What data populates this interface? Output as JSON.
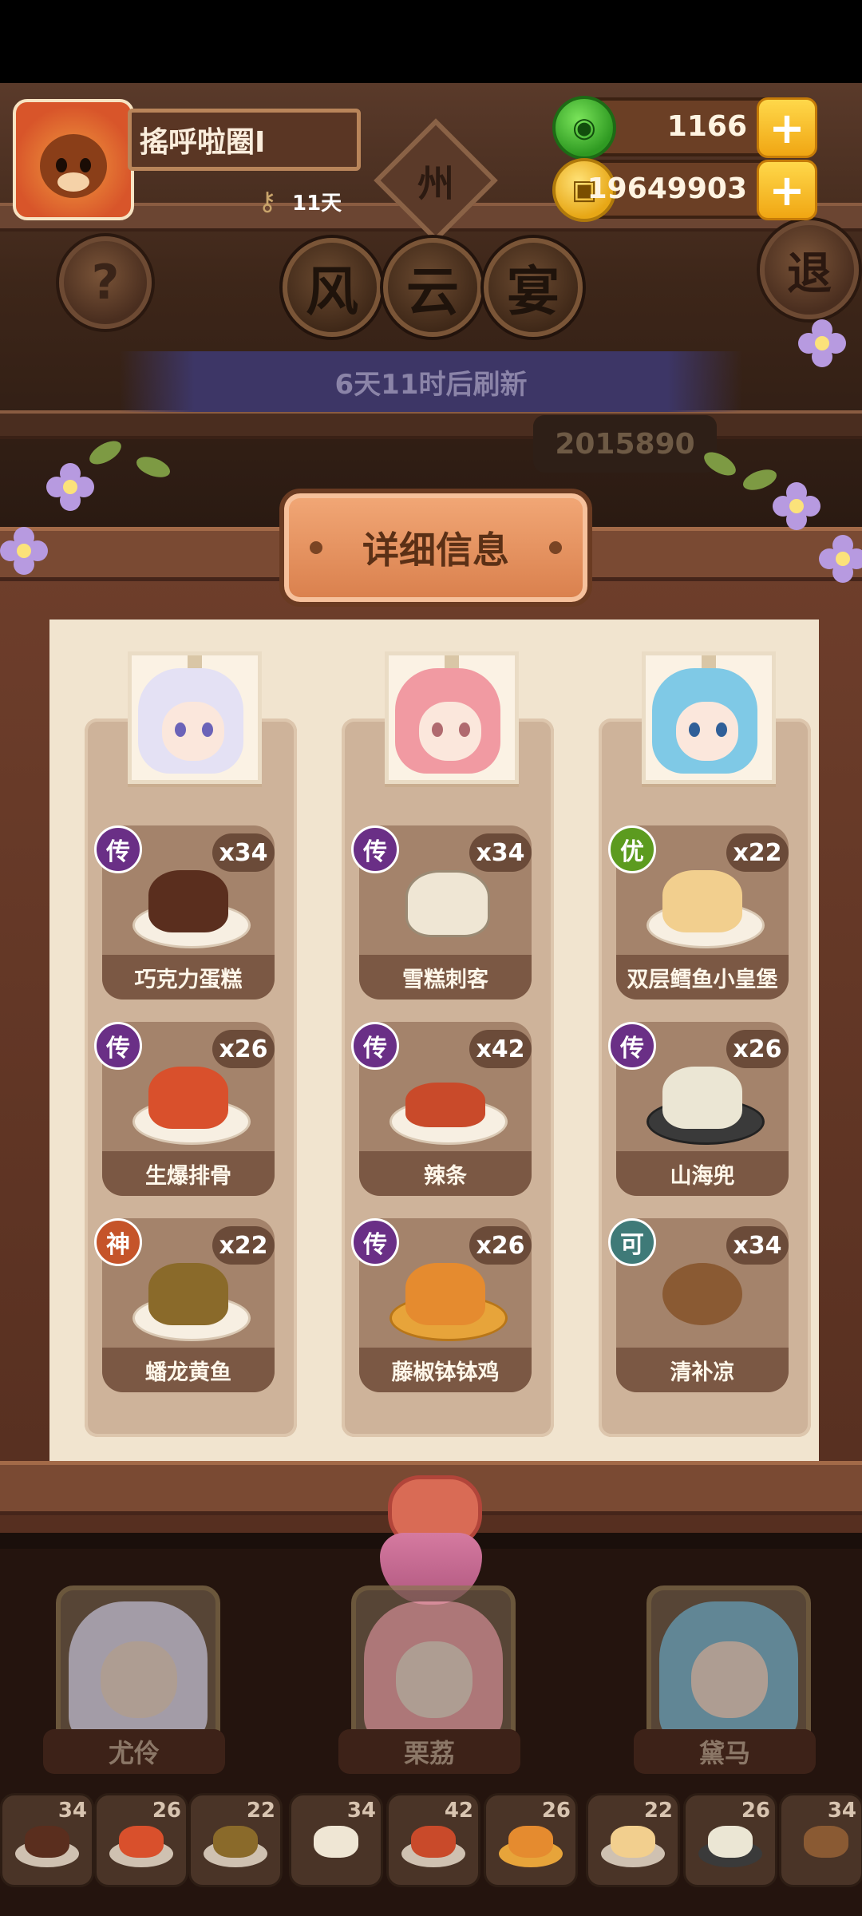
{
  "player": {
    "name": "搖呼啦圈I",
    "days": "11天"
  },
  "currency": {
    "jade": "1166",
    "gold": "19649903"
  },
  "top": {
    "sign": "州",
    "title_chars": [
      "风",
      "云",
      "宴"
    ],
    "refresh": "6天11时后刷新",
    "score": "2015890",
    "help_label": "?",
    "exit_label": "退"
  },
  "panel": {
    "title": "详细信息",
    "columns": [
      {
        "dishes": [
          {
            "grade": "传",
            "count": "x34",
            "name": "巧克力蛋糕"
          },
          {
            "grade": "传",
            "count": "x26",
            "name": "生爆排骨"
          },
          {
            "grade": "神",
            "count": "x22",
            "name": "蟠龙黄鱼"
          }
        ]
      },
      {
        "dishes": [
          {
            "grade": "传",
            "count": "x34",
            "name": "雪糕刺客"
          },
          {
            "grade": "传",
            "count": "x42",
            "name": "辣条"
          },
          {
            "grade": "传",
            "count": "x26",
            "name": "藤椒钵钵鸡"
          }
        ]
      },
      {
        "dishes": [
          {
            "grade": "优",
            "count": "x22",
            "name": "双层鳕鱼小皇堡"
          },
          {
            "grade": "传",
            "count": "x26",
            "name": "山海兜"
          },
          {
            "grade": "可",
            "count": "x34",
            "name": "清补凉"
          }
        ]
      }
    ]
  },
  "characters": [
    "尤伶",
    "栗荔",
    "黛马"
  ],
  "bottom_dishes": [
    "34",
    "26",
    "22",
    "34",
    "42",
    "26",
    "22",
    "26",
    "34"
  ],
  "colors": {
    "grade_legend": "#6a2f86",
    "grade_god": "#c5542a",
    "grade_good": "#5c9b1f",
    "grade_ok": "#3f7a78"
  }
}
